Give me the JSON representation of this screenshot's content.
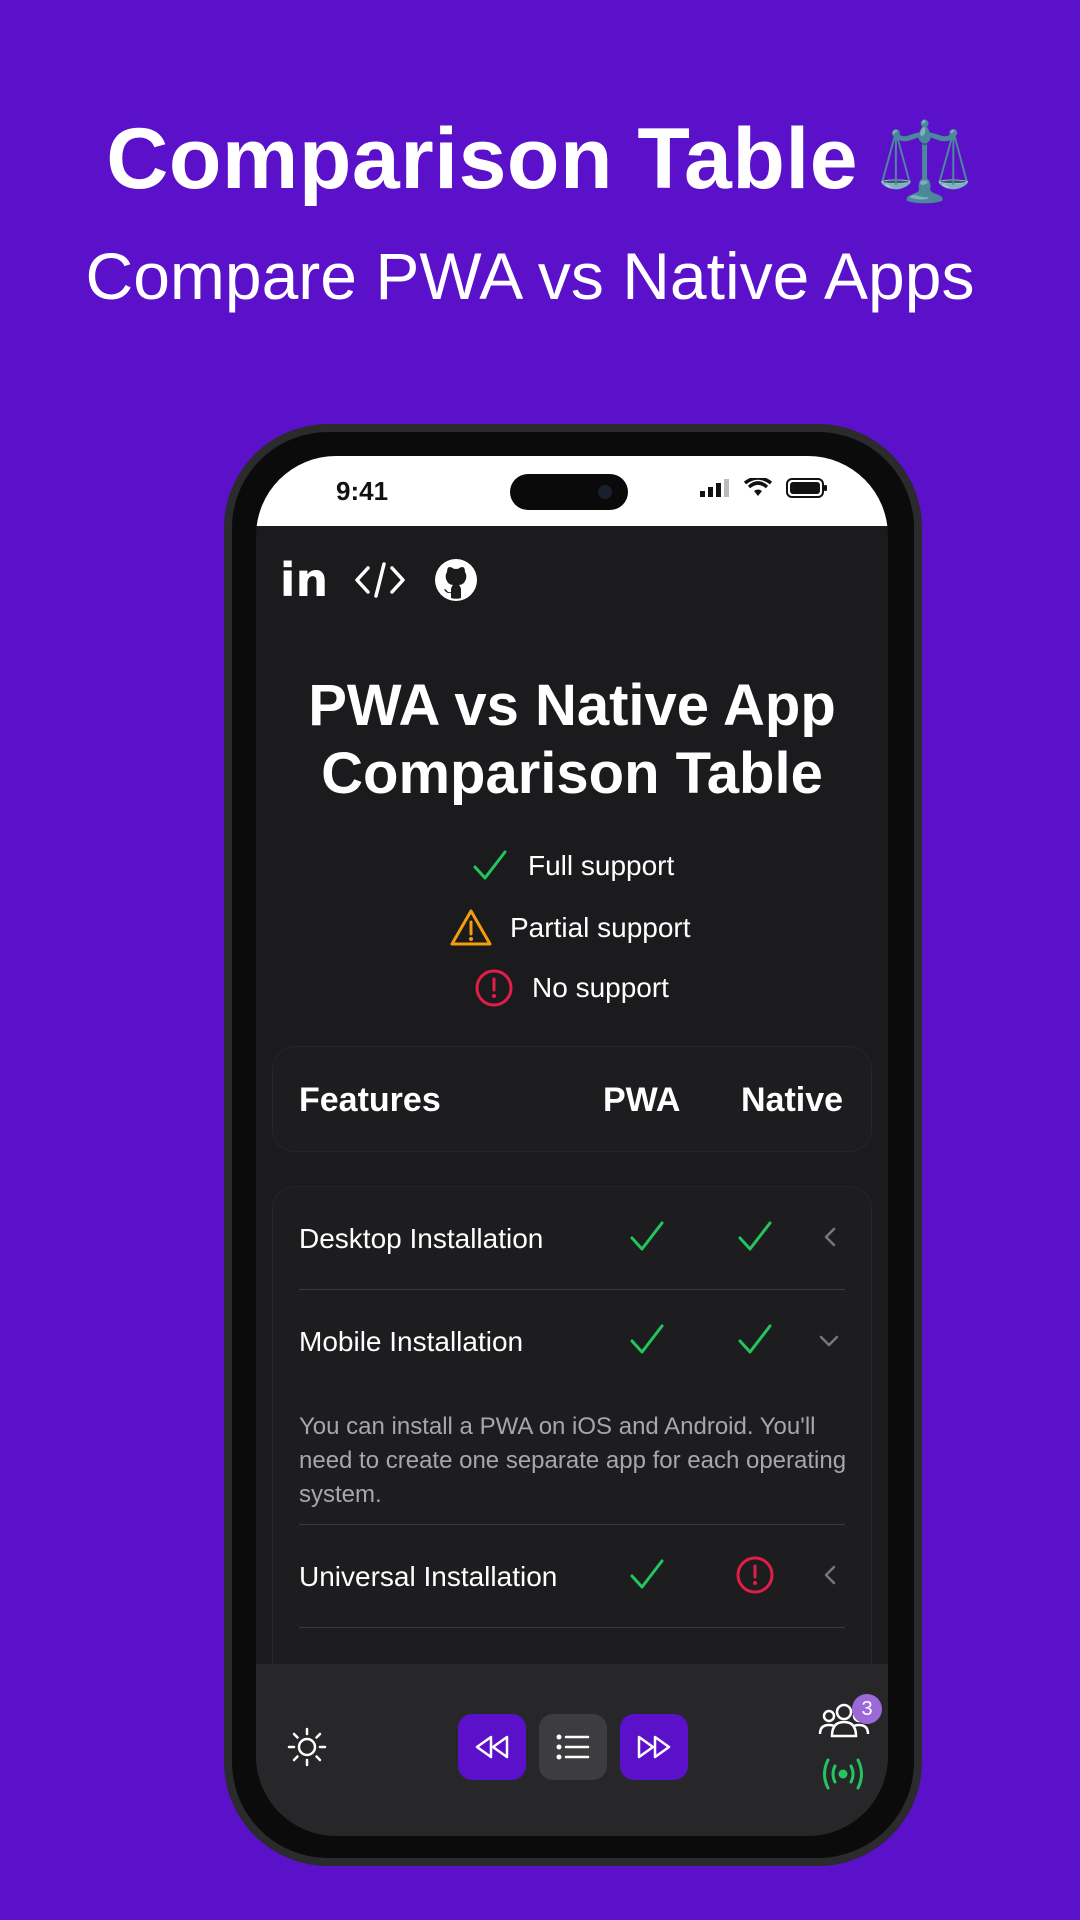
{
  "promo": {
    "title": "Comparison Table",
    "title_emoji": "⚖️",
    "subtitle": "Compare PWA vs Native Apps"
  },
  "status_bar": {
    "time": "9:41"
  },
  "social_links": [
    {
      "icon": "linkedin-icon",
      "label": "in"
    },
    {
      "icon": "code-icon"
    },
    {
      "icon": "github-icon"
    }
  ],
  "page": {
    "title_line1": "PWA vs Native App",
    "title_line2": "Comparison Table"
  },
  "legend": [
    {
      "icon": "check-icon",
      "label": "Full support",
      "color": "#22c55e"
    },
    {
      "icon": "warning-icon",
      "label": "Partial support",
      "color": "#f59e0b"
    },
    {
      "icon": "alert-circle-icon",
      "label": "No support",
      "color": "#e11d48"
    }
  ],
  "table": {
    "headers": {
      "features": "Features",
      "pwa": "PWA",
      "native": "Native"
    },
    "rows": [
      {
        "feature": "Desktop Installation",
        "pwa": "full",
        "native": "full",
        "expanded": false
      },
      {
        "feature": "Mobile Installation",
        "pwa": "full",
        "native": "full",
        "expanded": true,
        "description": "You can install a PWA on iOS and Android. You'll need to create one separate app for each operating system."
      },
      {
        "feature": "Universal Installation",
        "pwa": "full",
        "native": "none",
        "expanded": false
      }
    ]
  },
  "bottom_bar": {
    "theme_icon": "sun-icon",
    "prev_icon": "rewind-icon",
    "list_icon": "list-icon",
    "next_icon": "fast-forward-icon",
    "users_icon": "users-icon",
    "users_count": "3",
    "broadcast_icon": "broadcast-icon"
  },
  "colors": {
    "background": "#5b10c9",
    "screen": "#1b1b1d",
    "success": "#22c55e",
    "warning": "#f59e0b",
    "danger": "#e11d48",
    "accent": "#5b10c9"
  }
}
